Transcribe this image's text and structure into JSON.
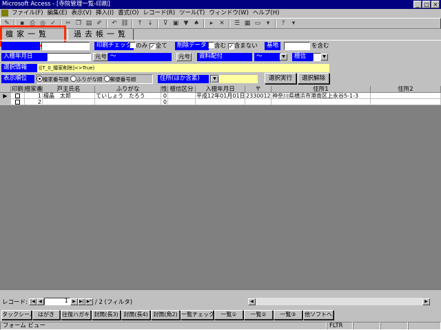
{
  "window": {
    "title": "Microsoft Access - [寺院管理一覧-印刷]"
  },
  "menu": [
    "ファイル(F)",
    "編集(E)",
    "表示(V)",
    "挿入(I)",
    "書式(O)",
    "レコード(R)",
    "ツール(T)",
    "ウィンドウ(W)",
    "ヘルプ(H)"
  ],
  "tabs": {
    "active": "檀家一覧",
    "inactive": "過去帳一覧"
  },
  "filters": {
    "print_check_label": "印刷チェック",
    "only_label": "のみ",
    "all_label": "全て",
    "delete_data_label": "削除データ",
    "include_label": "含む",
    "exclude_label": "含まない",
    "base_label": "基地",
    "contains_suffix": "を含む",
    "entry_date_label": "入檀年月日",
    "gengo1": "元号",
    "tilde": "～",
    "gengo2": "元号",
    "shiryo_label": "資料配付",
    "shiryo_tilde": "～",
    "kubun_label": "檀信",
    "selection_info_label": "選択情報",
    "selection_info_value": "([T_0_檀家削除]<>True)",
    "sort_label": "表示順位",
    "sort_options": [
      "檀家番号順",
      "ふりがな順",
      "郵便番号順"
    ],
    "address_label": "住所(ほか含素)",
    "run_button": "選択実行",
    "clear_button": "選択解除"
  },
  "grid": {
    "headers": [
      "印刷",
      "檀家番",
      "戸主氏名",
      "ふりがな",
      "性",
      "檀信区分",
      "入檀年月日",
      "〒",
      "住所1",
      "住所2"
    ],
    "rows": [
      {
        "no": "1",
        "name": "檀晶　太郎",
        "kana": "ていしょう　たろう",
        "sex": "0",
        "date": "平成12年01月01日",
        "zip": "2330012",
        "addr1": "神奈川県横浜市港南区上永谷5-1-3"
      },
      {
        "no": "2",
        "name": "",
        "kana": "",
        "sex": "0",
        "date": "",
        "zip": "",
        "addr1": ""
      }
    ]
  },
  "nav": {
    "label": "レコード:",
    "current": "1",
    "total": "/ 2 (フィルタ)"
  },
  "bottom_buttons": [
    "タックシール",
    "はがき",
    "往復ハガキ",
    "封筒(長3)",
    "封筒(長4)",
    "封筒(角2)",
    "一覧チェック",
    "一覧①",
    "一覧②",
    "一覧③",
    "他ソフトへ"
  ],
  "status": {
    "left": "フォーム ビュー",
    "right": "FLTR"
  }
}
